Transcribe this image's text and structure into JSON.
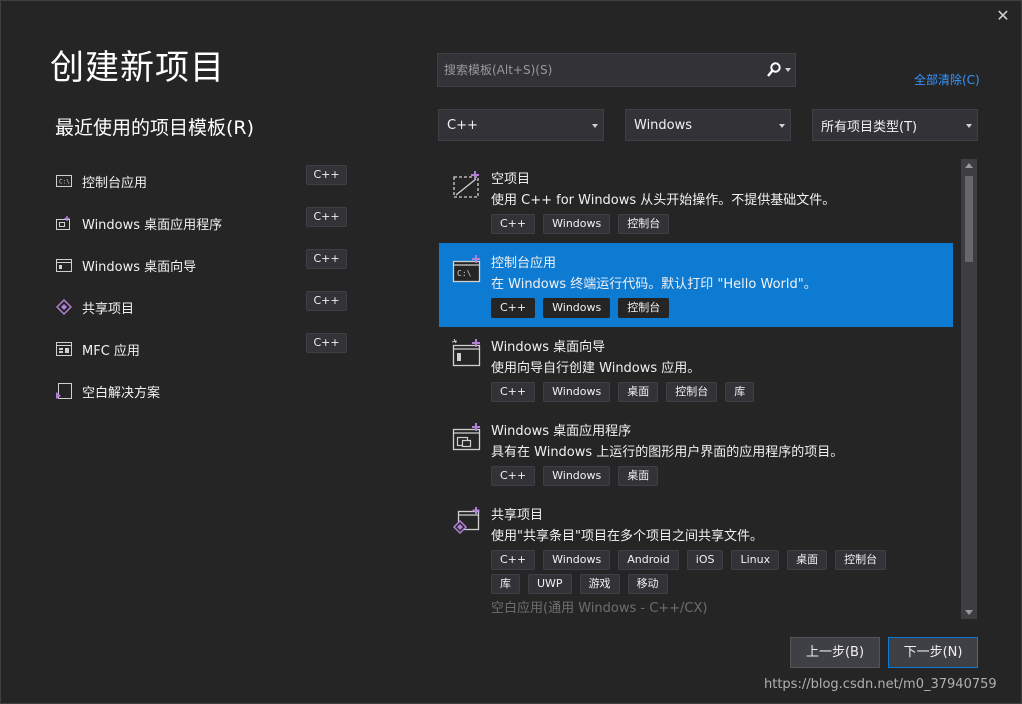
{
  "window": {
    "close_glyph": "✕"
  },
  "page_title": "创建新项目",
  "recent": {
    "title": "最近使用的项目模板(R)",
    "items": [
      {
        "label": "控制台应用",
        "badge": "C++",
        "icon": "console-app-icon"
      },
      {
        "label": "Windows 桌面应用程序",
        "badge": "C++",
        "icon": "windows-desktop-app-icon"
      },
      {
        "label": "Windows 桌面向导",
        "badge": "C++",
        "icon": "windows-desktop-wizard-icon"
      },
      {
        "label": "共享项目",
        "badge": "C++",
        "icon": "shared-project-icon"
      },
      {
        "label": "MFC 应用",
        "badge": "C++",
        "icon": "mfc-app-icon"
      },
      {
        "label": "空白解决方案",
        "badge": "",
        "icon": "blank-solution-icon"
      }
    ]
  },
  "search": {
    "placeholder": "搜索模板(Alt+S)(S)"
  },
  "clear_all": "全部清除(C)",
  "filters": {
    "language": "C++",
    "platform": "Windows",
    "project_type": "所有项目类型(T)"
  },
  "templates": [
    {
      "name": "空项目",
      "desc": "使用 C++ for Windows 从头开始操作。不提供基础文件。",
      "tags": [
        "C++",
        "Windows",
        "控制台"
      ],
      "icon": "empty-project-icon"
    },
    {
      "name": "控制台应用",
      "desc": "在 Windows 终端运行代码。默认打印 \"Hello World\"。",
      "tags": [
        "C++",
        "Windows",
        "控制台"
      ],
      "icon": "console-app-icon"
    },
    {
      "name": "Windows 桌面向导",
      "desc": "使用向导自行创建 Windows 应用。",
      "tags": [
        "C++",
        "Windows",
        "桌面",
        "控制台",
        "库"
      ],
      "icon": "windows-desktop-wizard-icon"
    },
    {
      "name": "Windows 桌面应用程序",
      "desc": "具有在 Windows 上运行的图形用户界面的应用程序的项目。",
      "tags": [
        "C++",
        "Windows",
        "桌面"
      ],
      "icon": "windows-desktop-app-icon"
    },
    {
      "name": "共享项目",
      "desc": "使用\"共享条目\"项目在多个项目之间共享文件。",
      "tags": [
        "C++",
        "Windows",
        "Android",
        "iOS",
        "Linux",
        "桌面",
        "控制台",
        "库",
        "UWP",
        "游戏",
        "移动"
      ],
      "icon": "shared-project-icon"
    },
    {
      "name": "空白应用(通用 Windows - C++/CX)",
      "icon": "uwp-app-icon"
    }
  ],
  "selected_template_index": 1,
  "scroll_fraction": 0.0,
  "buttons": {
    "back": "上一步(B)",
    "next": "下一步(N)"
  },
  "watermark": "https://blog.csdn.net/m0_37940759",
  "colors": {
    "background": "#252526",
    "selected": "#0e7bd3",
    "link": "#3794ff",
    "accent_purple": "#b180d7"
  }
}
